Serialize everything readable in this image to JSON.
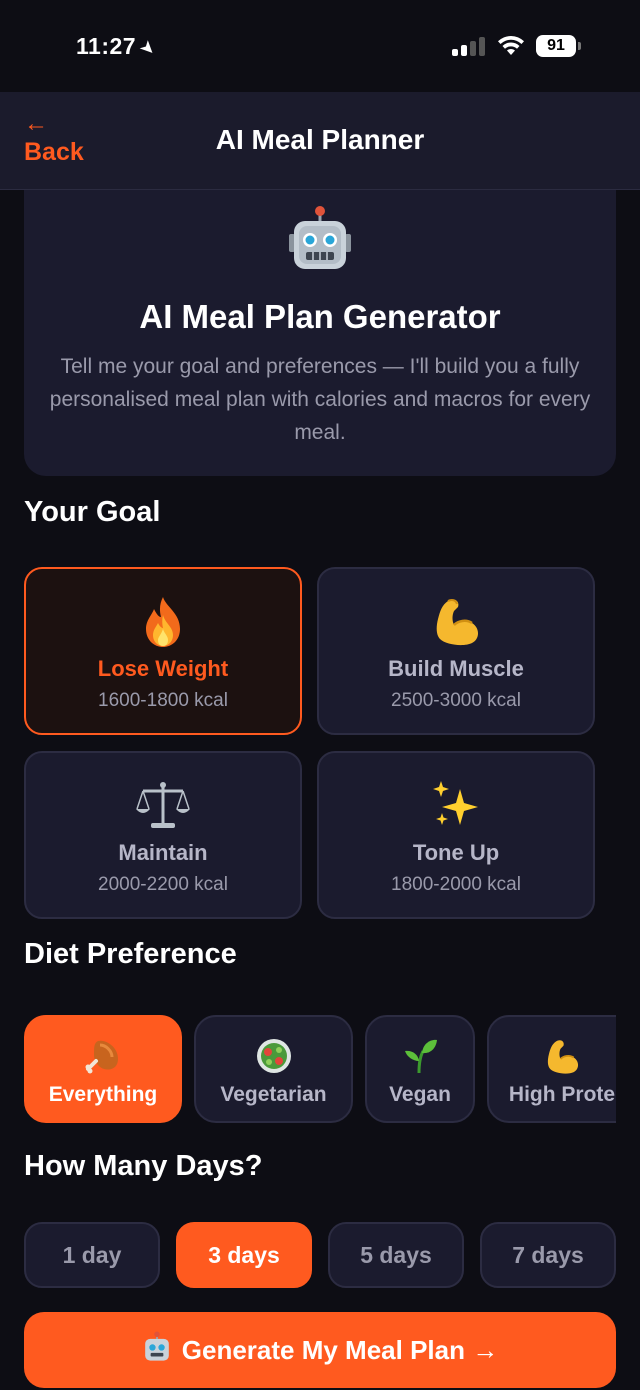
{
  "status_bar": {
    "time": "11:27",
    "battery": "91"
  },
  "nav": {
    "back_arrow": "←",
    "back_label": "Back",
    "title": "AI Meal Planner"
  },
  "hero": {
    "icon": "robot-icon",
    "title": "AI Meal Plan Generator",
    "description": "Tell me your goal and preferences — I'll build you a fully personalised meal plan with calories and macros for every meal."
  },
  "goal_section": {
    "title": "Your Goal",
    "options": [
      {
        "name": "Lose Weight",
        "kcal": "1600-1800 kcal",
        "icon": "fire-icon",
        "selected": true
      },
      {
        "name": "Build Muscle",
        "kcal": "2500-3000 kcal",
        "icon": "flexed-biceps-icon",
        "selected": false
      },
      {
        "name": "Maintain",
        "kcal": "2000-2200 kcal",
        "icon": "balance-scale-icon",
        "selected": false
      },
      {
        "name": "Tone Up",
        "kcal": "1800-2000 kcal",
        "icon": "sparkles-icon",
        "selected": false
      }
    ]
  },
  "diet_section": {
    "title": "Diet Preference",
    "options": [
      {
        "label": "Everything",
        "icon": "poultry-leg-icon",
        "selected": true
      },
      {
        "label": "Vegetarian",
        "icon": "salad-icon",
        "selected": false
      },
      {
        "label": "Vegan",
        "icon": "seedling-icon",
        "selected": false
      },
      {
        "label": "High Prote",
        "icon": "flexed-biceps-icon",
        "selected": false
      }
    ]
  },
  "days_section": {
    "title": "How Many Days?",
    "options": [
      {
        "label": "1 day",
        "selected": false
      },
      {
        "label": "3 days",
        "selected": true
      },
      {
        "label": "5 days",
        "selected": false
      },
      {
        "label": "7 days",
        "selected": false
      }
    ]
  },
  "generate_button": {
    "icon": "robot-icon",
    "label": "Generate My Meal Plan →"
  },
  "colors": {
    "accent": "#ff5a1f",
    "background": "#0d0d14",
    "card": "#1b1b2e"
  }
}
